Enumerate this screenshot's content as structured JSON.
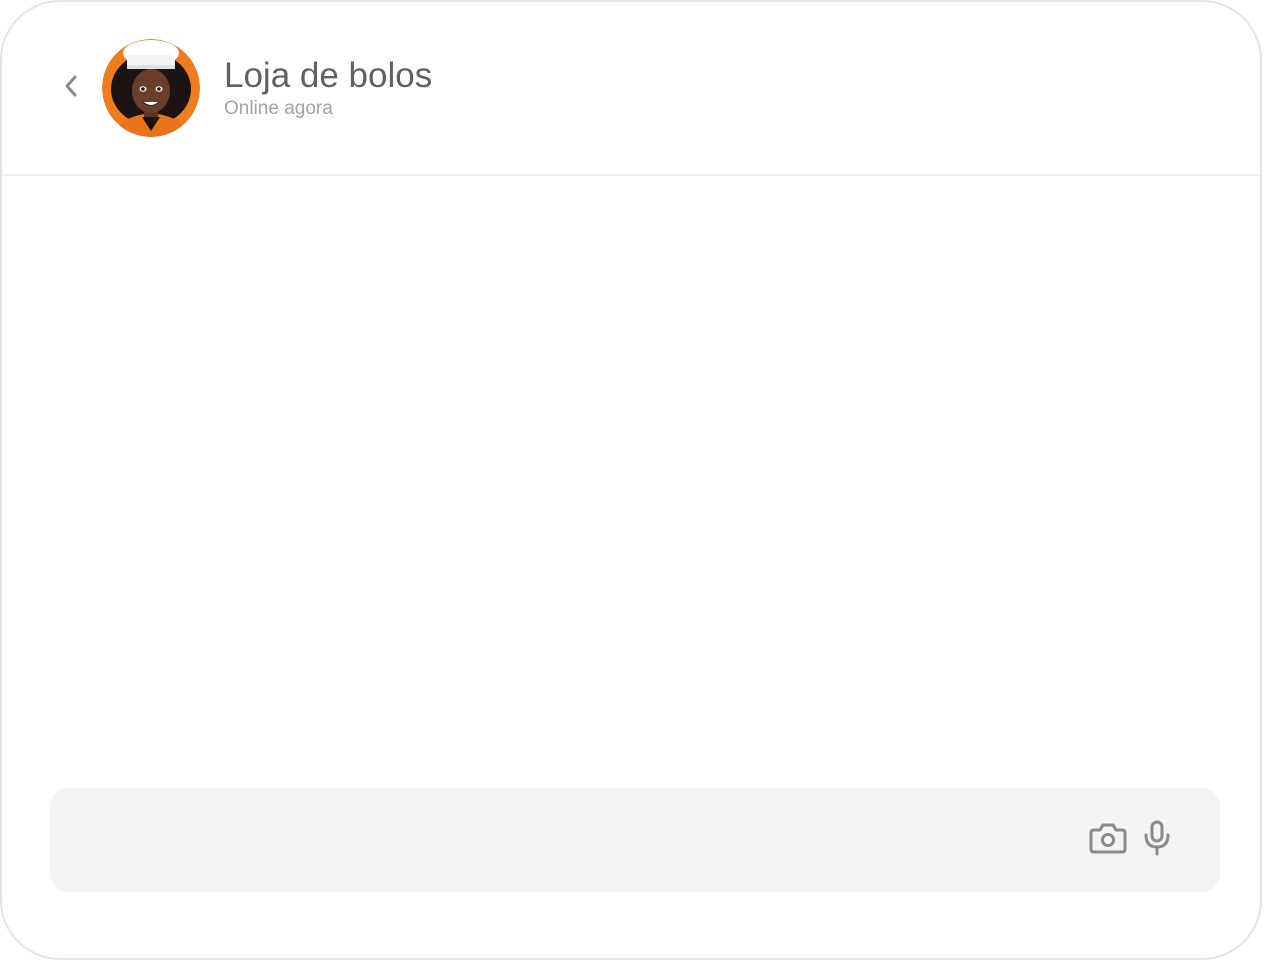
{
  "header": {
    "back_icon": "chevron-left-icon",
    "contact_name": "Loja de bolos",
    "status": "Online agora",
    "avatar_description_icon": "avatar-chef"
  },
  "composer": {
    "message_value": "",
    "camera_icon": "camera-icon",
    "mic_icon": "microphone-icon"
  },
  "colors": {
    "accent_orange": "#f07c1f",
    "icon_gray": "#8a8a8a",
    "composer_bg": "#f4f4f4"
  }
}
